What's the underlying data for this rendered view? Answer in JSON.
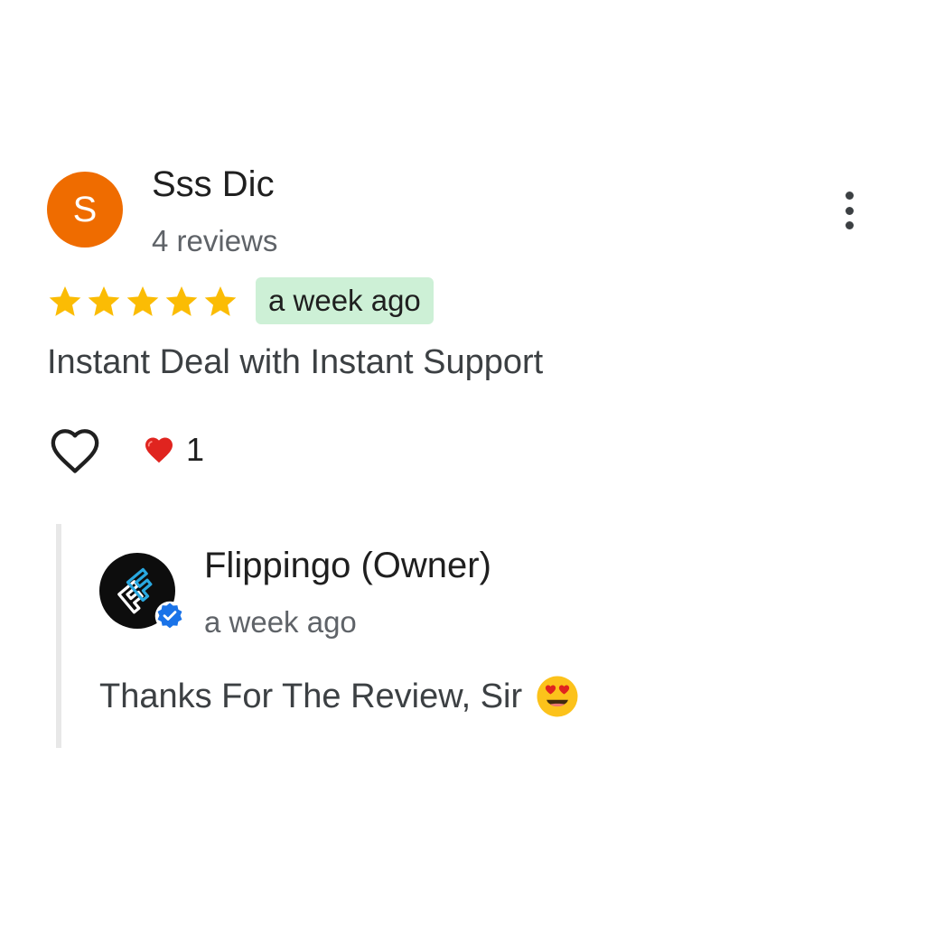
{
  "review": {
    "author": {
      "initial": "S",
      "name": "Sss Dic",
      "meta": "4 reviews",
      "avatar_color": "#ef6c00"
    },
    "rating": 5,
    "rating_max": 5,
    "star_color": "#fbbc04",
    "date": "a week ago",
    "date_chip_color": "#cdf0d6",
    "text": "Instant Deal with Instant Support",
    "menu_icon": "more-vert-icon",
    "like_icon": "heart-outline-icon",
    "reaction": {
      "icon": "red-heart-icon",
      "count": "1"
    }
  },
  "owner_reply": {
    "name": "Flippingo (Owner)",
    "date": "a week ago",
    "text": "Thanks For The Review, Sir",
    "emoji_icon": "heart-eyes-emoji-icon",
    "verified_icon": "verified-badge-icon",
    "logo_colors": [
      "#29a8e0",
      "#ffffff"
    ],
    "verified_color": "#1a73e8"
  }
}
